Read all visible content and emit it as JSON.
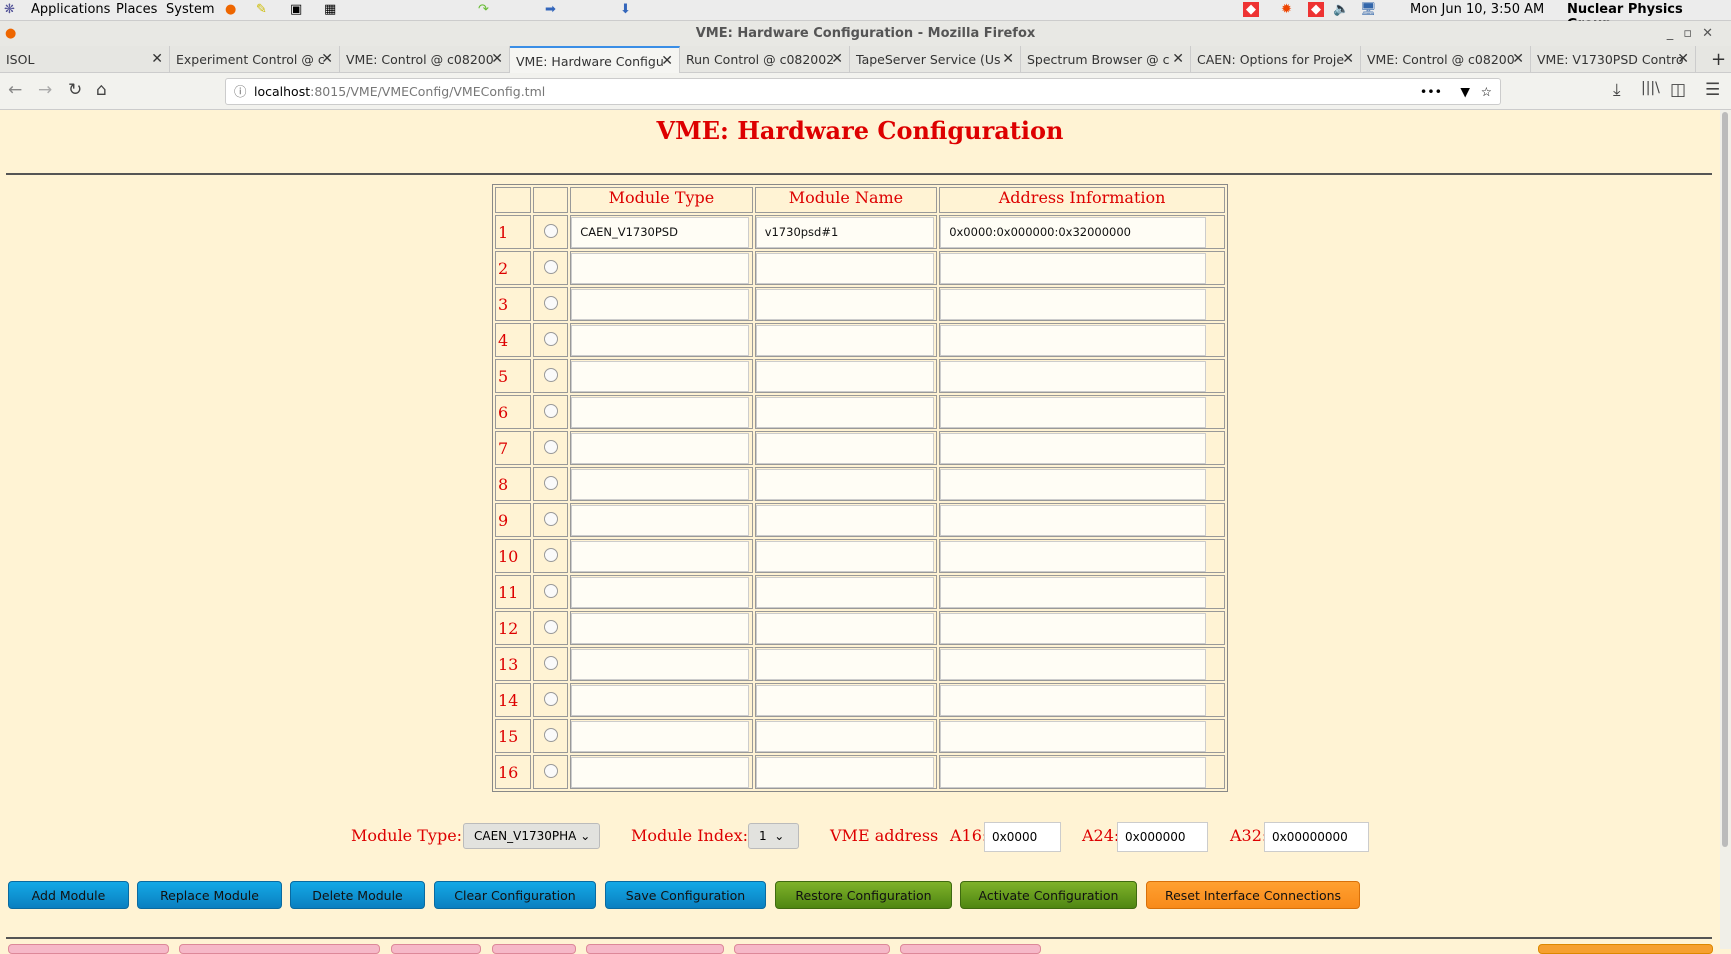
{
  "panel": {
    "applications": "Applications",
    "places": "Places",
    "system": "System",
    "clock": "Mon Jun 10,  3:50 AM",
    "user": "Nuclear Physics Group"
  },
  "window": {
    "title": "VME: Hardware Configuration - Mozilla Firefox"
  },
  "tabs": [
    {
      "label": "ISOL"
    },
    {
      "label": "Experiment Control @ c"
    },
    {
      "label": "VME: Control @ c08200"
    },
    {
      "label": "VME: Hardware Configu"
    },
    {
      "label": "Run Control @ c082002"
    },
    {
      "label": "TapeServer Service (Us"
    },
    {
      "label": "Spectrum Browser @ c"
    },
    {
      "label": "CAEN: Options for Proje"
    },
    {
      "label": "VME: Control @ c08200"
    },
    {
      "label": "VME: V1730PSD Contro"
    }
  ],
  "url": {
    "host": "localhost",
    "path": ":8015/VME/VMEConfig/VMEConfig.tml"
  },
  "page": {
    "title": "VME: Hardware Configuration"
  },
  "table": {
    "headers": [
      "Module Type",
      "Module Name",
      "Address Information"
    ],
    "rows": [
      {
        "index": "1",
        "type": "CAEN_V1730PSD",
        "name": "v1730psd#1",
        "address": "0x0000:0x000000:0x32000000"
      },
      {
        "index": "2",
        "type": "",
        "name": "",
        "address": ""
      },
      {
        "index": "3",
        "type": "",
        "name": "",
        "address": ""
      },
      {
        "index": "4",
        "type": "",
        "name": "",
        "address": ""
      },
      {
        "index": "5",
        "type": "",
        "name": "",
        "address": ""
      },
      {
        "index": "6",
        "type": "",
        "name": "",
        "address": ""
      },
      {
        "index": "7",
        "type": "",
        "name": "",
        "address": ""
      },
      {
        "index": "8",
        "type": "",
        "name": "",
        "address": ""
      },
      {
        "index": "9",
        "type": "",
        "name": "",
        "address": ""
      },
      {
        "index": "10",
        "type": "",
        "name": "",
        "address": ""
      },
      {
        "index": "11",
        "type": "",
        "name": "",
        "address": ""
      },
      {
        "index": "12",
        "type": "",
        "name": "",
        "address": ""
      },
      {
        "index": "13",
        "type": "",
        "name": "",
        "address": ""
      },
      {
        "index": "14",
        "type": "",
        "name": "",
        "address": ""
      },
      {
        "index": "15",
        "type": "",
        "name": "",
        "address": ""
      },
      {
        "index": "16",
        "type": "",
        "name": "",
        "address": ""
      }
    ]
  },
  "controls": {
    "module_type_label": "Module Type:",
    "module_type_value": "CAEN_V1730PHA",
    "module_index_label": "Module Index:",
    "module_index_value": "1",
    "vme_address_label": "VME address",
    "a16_label": "A16:",
    "a16_value": "0x0000",
    "a24_label": "A24:",
    "a24_value": "0x000000",
    "a32_label": "A32:",
    "a32_value": "0x00000000"
  },
  "buttons": {
    "add": "Add Module",
    "replace": "Replace Module",
    "delete": "Delete Module",
    "clear": "Clear Configuration",
    "save": "Save Configuration",
    "restore": "Restore Configuration",
    "activate": "Activate Configuration",
    "reset": "Reset Interface Connections"
  }
}
